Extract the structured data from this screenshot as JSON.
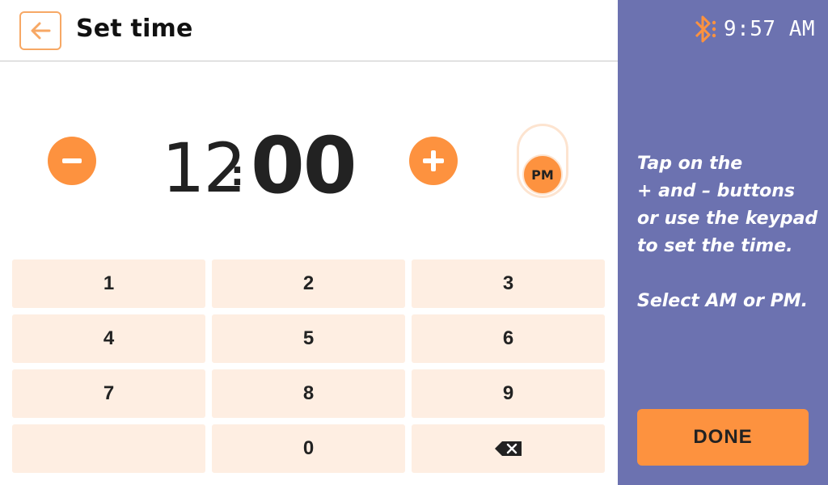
{
  "header": {
    "title": "Set time",
    "back_icon": "arrow-left-icon"
  },
  "status": {
    "bluetooth_icon": "bluetooth-icon",
    "clock": "9:57 AM"
  },
  "time": {
    "hours": "12",
    "separator": ":",
    "minutes": "00",
    "period": "PM"
  },
  "controls": {
    "decrement_icon": "minus-icon",
    "increment_icon": "plus-icon"
  },
  "keypad": {
    "keys": [
      "1",
      "2",
      "3",
      "4",
      "5",
      "6",
      "7",
      "8",
      "9",
      "",
      "0"
    ],
    "backspace_icon": "backspace-icon"
  },
  "instructions": {
    "lines": [
      "Tap on the",
      "+ and – buttons",
      "or use the keypad",
      "to set the time."
    ],
    "note": "Select AM or PM."
  },
  "done_label": "DONE",
  "colors": {
    "accent": "#fd923f",
    "accent_light": "#feeee2",
    "panel": "#6c72b0"
  }
}
